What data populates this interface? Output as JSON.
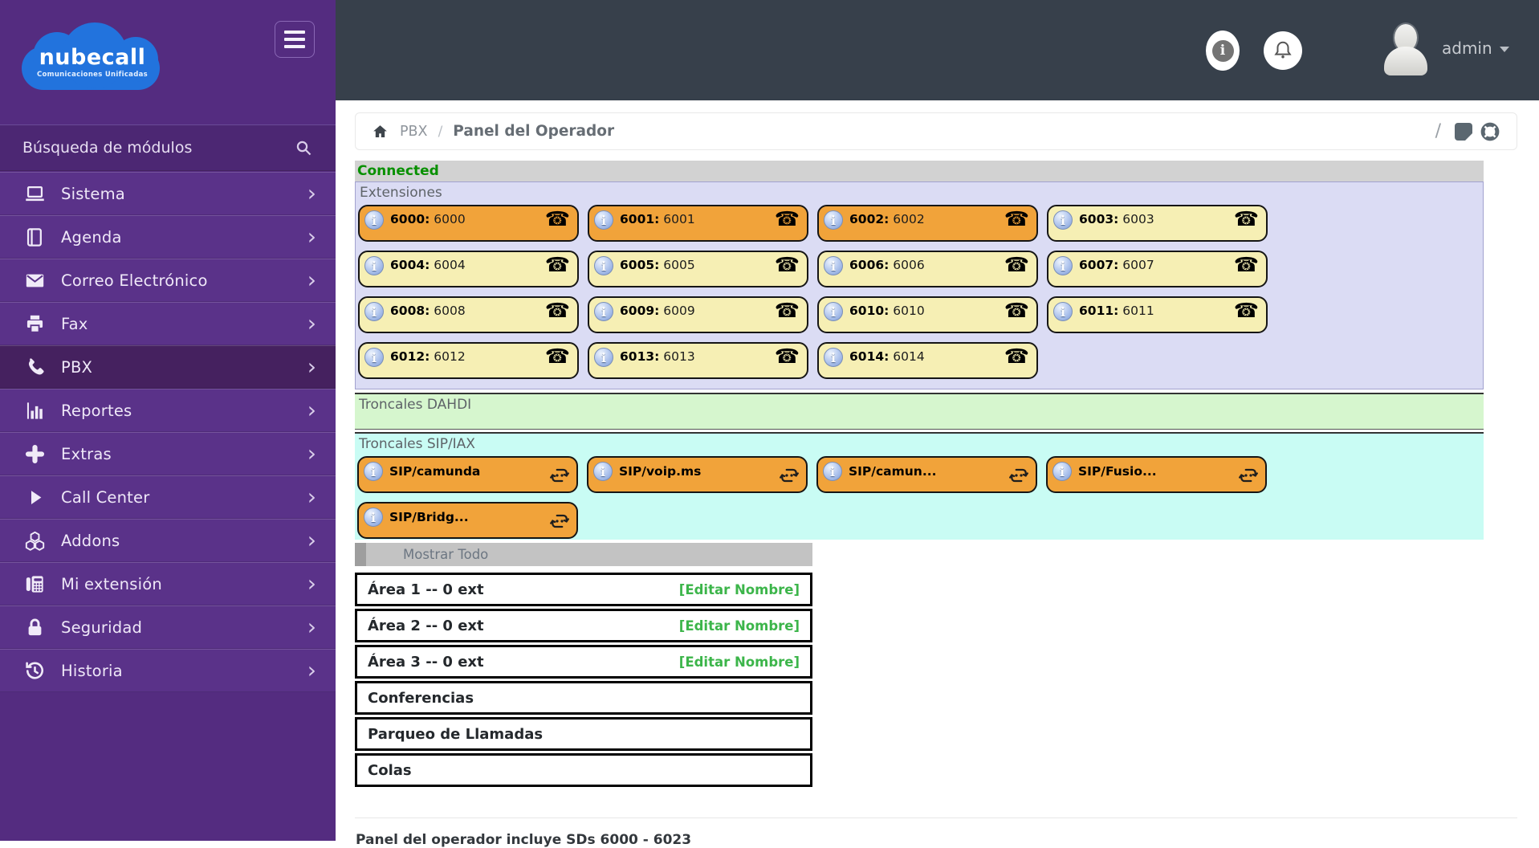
{
  "brand": {
    "name": "nubecall",
    "tagline": "Comunicaciones Unificadas"
  },
  "topbar": {
    "user": "admin"
  },
  "sidebar": {
    "search_label": "Búsqueda de módulos",
    "items": [
      {
        "label": "Sistema",
        "icon": "laptop-icon",
        "active": false
      },
      {
        "label": "Agenda",
        "icon": "book-icon",
        "active": false
      },
      {
        "label": "Correo Electrónico",
        "icon": "envelope-icon",
        "active": false
      },
      {
        "label": "Fax",
        "icon": "printer-icon",
        "active": false
      },
      {
        "label": "PBX",
        "icon": "phone-icon",
        "active": true
      },
      {
        "label": "Reportes",
        "icon": "bar-chart-icon",
        "active": false
      },
      {
        "label": "Extras",
        "icon": "plus-icon",
        "active": false
      },
      {
        "label": "Call Center",
        "icon": "play-icon",
        "active": false
      },
      {
        "label": "Addons",
        "icon": "cubes-icon",
        "active": false
      },
      {
        "label": "Mi extensión",
        "icon": "fax-machine-icon",
        "active": false
      },
      {
        "label": "Seguridad",
        "icon": "lock-icon",
        "active": false
      },
      {
        "label": "Historia",
        "icon": "history-icon",
        "active": false
      }
    ]
  },
  "breadcrumb": {
    "section": "PBX",
    "sep": "/",
    "page": "Panel del Operador",
    "trailing_separator": "/"
  },
  "status": {
    "connected_label": "Connected"
  },
  "extensions": {
    "title": "Extensiones",
    "items": [
      {
        "ext": "6000",
        "name": "6000",
        "state": "busy"
      },
      {
        "ext": "6001",
        "name": "6001",
        "state": "busy"
      },
      {
        "ext": "6002",
        "name": "6002",
        "state": "busy"
      },
      {
        "ext": "6003",
        "name": "6003",
        "state": "idle"
      },
      {
        "ext": "6004",
        "name": "6004",
        "state": "idle"
      },
      {
        "ext": "6005",
        "name": "6005",
        "state": "idle"
      },
      {
        "ext": "6006",
        "name": "6006",
        "state": "idle"
      },
      {
        "ext": "6007",
        "name": "6007",
        "state": "idle"
      },
      {
        "ext": "6008",
        "name": "6008",
        "state": "idle"
      },
      {
        "ext": "6009",
        "name": "6009",
        "state": "idle"
      },
      {
        "ext": "6010",
        "name": "6010",
        "state": "idle"
      },
      {
        "ext": "6011",
        "name": "6011",
        "state": "idle"
      },
      {
        "ext": "6012",
        "name": "6012",
        "state": "idle"
      },
      {
        "ext": "6013",
        "name": "6013",
        "state": "idle"
      },
      {
        "ext": "6014",
        "name": "6014",
        "state": "idle"
      }
    ]
  },
  "trunks_dahdi": {
    "title": "Troncales DAHDI"
  },
  "trunks_sip": {
    "title": "Troncales SIP/IAX",
    "items": [
      "SIP/camunda",
      "SIP/voip.ms",
      "SIP/camun...",
      "SIP/Fusio...",
      "SIP/Bridg..."
    ]
  },
  "areas_header": {
    "show_all_label": "Mostrar Todo"
  },
  "areas": [
    {
      "label": "Área 1 -- 0 ext",
      "action": "[Editar Nombre]"
    },
    {
      "label": "Área 2 -- 0 ext",
      "action": "[Editar Nombre]"
    },
    {
      "label": "Área 3 -- 0 ext",
      "action": "[Editar Nombre]"
    },
    {
      "label": "Conferencias",
      "action": ""
    },
    {
      "label": "Parqueo de Llamadas",
      "action": ""
    },
    {
      "label": "Colas",
      "action": ""
    }
  ],
  "footer_note": "Panel del operador incluye SDs 6000 - 6023",
  "colors": {
    "sidebar_base": "#542c80",
    "sidebar_row": "#5a3289",
    "sidebar_active": "#45215f",
    "sidebar_search": "#4c2773",
    "topbar": "#37404b",
    "brand_blue": "#2273dd",
    "busy_orange": "#f1a33a",
    "idle_yellow": "#f6efb4",
    "panel_lavender": "#dbdcf4",
    "panel_green": "#d6f6ce",
    "panel_cyan": "#c9fcf4",
    "connected_green": "#089000",
    "link_green": "#3cb54a"
  }
}
